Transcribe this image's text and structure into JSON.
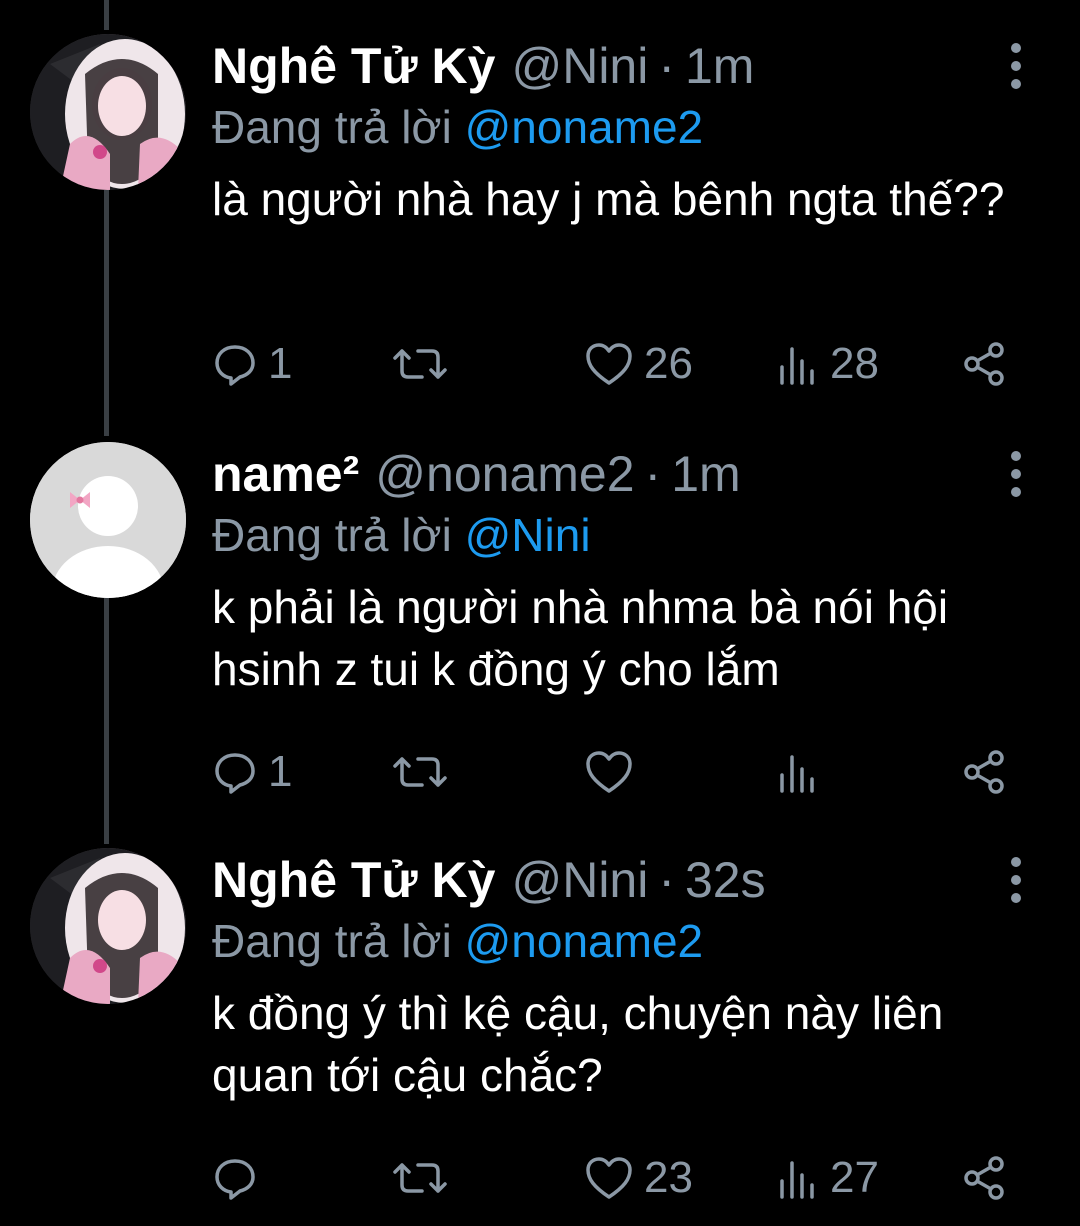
{
  "tweets": [
    {
      "name": "Nghê Tử Kỳ",
      "handle": "@Nini",
      "separator": "·",
      "time": "1m",
      "replying_prefix": "Đang trả lời",
      "replying_to": "@noname2",
      "text": "là người nhà hay j mà bênh ngta thế??",
      "replies": "1",
      "retweets": "",
      "likes": "26",
      "views": "28",
      "avatar": "photo-avatar"
    },
    {
      "name": "name²",
      "handle": "@noname2",
      "separator": "·",
      "time": "1m",
      "replying_prefix": "Đang trả lời",
      "replying_to": "@Nini",
      "text": "k phải là người nhà nhma bà nói hội hsinh z tui k đồng ý cho lắm",
      "replies": "1",
      "retweets": "",
      "likes": "",
      "views": "",
      "avatar": "default-avatar-with-bow"
    },
    {
      "name": "Nghê Tử Kỳ",
      "handle": "@Nini",
      "separator": "·",
      "time": "32s",
      "replying_prefix": "Đang trả lời",
      "replying_to": "@noname2",
      "text": "k đồng ý thì kệ cậu, chuyện này liên quan tới cậu chắc?",
      "replies": "",
      "retweets": "",
      "likes": "23",
      "views": "27",
      "avatar": "photo-avatar"
    }
  ],
  "icons": {
    "reply": "reply-icon",
    "retweet": "retweet-icon",
    "like": "heart-icon",
    "views": "views-icon",
    "share": "share-icon",
    "more": "more-icon"
  },
  "colors": {
    "background": "#000000",
    "text": "#ffffff",
    "muted": "#8b98a5",
    "link": "#1d9bf0",
    "thread_line": "#3a3f44"
  }
}
